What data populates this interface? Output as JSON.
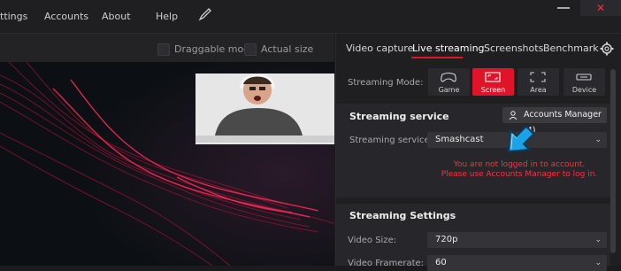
{
  "menu": {
    "settings": "ttings",
    "accounts": "Accounts",
    "about": "About",
    "help": "Help"
  },
  "window": {
    "close_glyph": "✕"
  },
  "toolbar": {
    "draggable_label": "Draggable mode",
    "actual_size_label": "Actual size"
  },
  "tabs": [
    {
      "label": "Video capture"
    },
    {
      "label": "Live streaming",
      "active": true
    },
    {
      "label": "Screenshots"
    },
    {
      "label": "Benchmark"
    }
  ],
  "streaming_mode": {
    "label": "Streaming Mode:",
    "options": [
      {
        "label": "Game",
        "icon": "gamepad-icon"
      },
      {
        "label": "Screen",
        "icon": "screen-icon",
        "active": true
      },
      {
        "label": "Area",
        "icon": "area-icon"
      },
      {
        "label": "Device",
        "icon": "device-icon"
      }
    ]
  },
  "streaming_service": {
    "title": "Streaming service",
    "accounts_button": "Accounts Manager (4)",
    "field_label": "Streaming service:",
    "value": "Smashcast",
    "error_line1": "You are not logged in to account.",
    "error_line2": "Please use Accounts Manager to log in."
  },
  "streaming_settings": {
    "title": "Streaming Settings",
    "video_size_label": "Video Size:",
    "video_size_value": "720p",
    "framerate_label": "Video Framerate:",
    "framerate_value": "60"
  },
  "colors": {
    "accent": "#e01429",
    "error": "#ff2e3e"
  }
}
